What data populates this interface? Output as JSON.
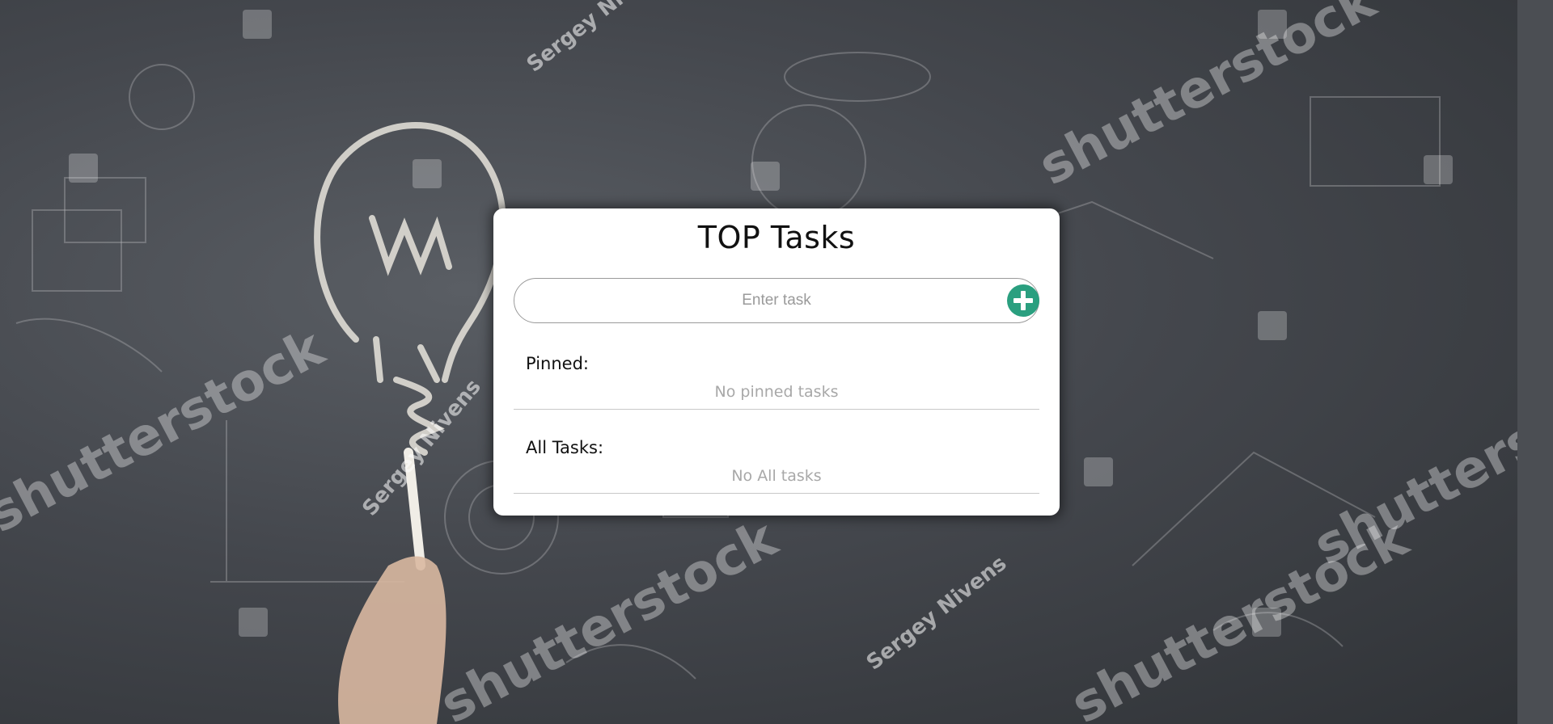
{
  "app": {
    "title": "TOP Tasks"
  },
  "task_form": {
    "input_value": "",
    "input_placeholder": "Enter task",
    "add_icon": "plus-circle-icon",
    "add_color": "#2a9f7f"
  },
  "sections": {
    "pinned": {
      "label": "Pinned:",
      "empty_text": "No pinned tasks"
    },
    "all": {
      "label": "All Tasks:",
      "empty_text": "No All tasks"
    }
  },
  "background": {
    "watermark": "shutterstock",
    "author": "Sergey Nivens"
  }
}
